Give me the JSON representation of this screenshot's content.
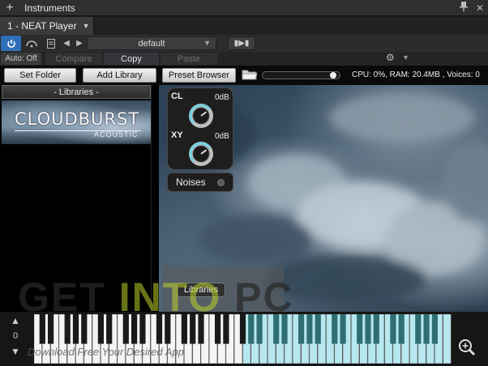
{
  "titlebar": {
    "plus": "+",
    "title": "Instruments",
    "pin": "◆",
    "close": "✕"
  },
  "instrument_tab": {
    "label": "1 - NEAT Player"
  },
  "preset_bar": {
    "preset_name": "default"
  },
  "compare_bar": {
    "auto_off": "Auto: Off",
    "compare": "Compare",
    "copy": "Copy",
    "paste": "Paste"
  },
  "plugin_toolbar": {
    "set_folder": "Set Folder",
    "add_library": "Add Library",
    "preset_browser": "Preset Browser",
    "volume_level": 0.95,
    "status": "CPU: 0%, RAM: 20.4MB , Voices: 0"
  },
  "library_panel": {
    "header": "- Libraries -",
    "items": [
      {
        "logo": "CLOUDBURST",
        "sub": "ACOUSTIC"
      }
    ]
  },
  "mixer": {
    "cl_label": "CL",
    "cl_value": "0dB",
    "cl_level": 0.7,
    "xy_label": "XY",
    "xy_value": "0dB",
    "xy_level": 0.7
  },
  "noises": {
    "label": "Noises"
  },
  "libraries_button": {
    "label": "Libraries"
  },
  "watermark": {
    "get": "GET ",
    "into": "INTO",
    "pc": " PC",
    "tagline": "Download Free Your Desired App"
  },
  "keyboard": {
    "octave": "0",
    "up": "▲",
    "down": "▼"
  },
  "colors": {
    "accent_blue": "#2f6fb7",
    "key_highlight": "#b6e8ee",
    "panel_bg": "#1e1e1e"
  }
}
